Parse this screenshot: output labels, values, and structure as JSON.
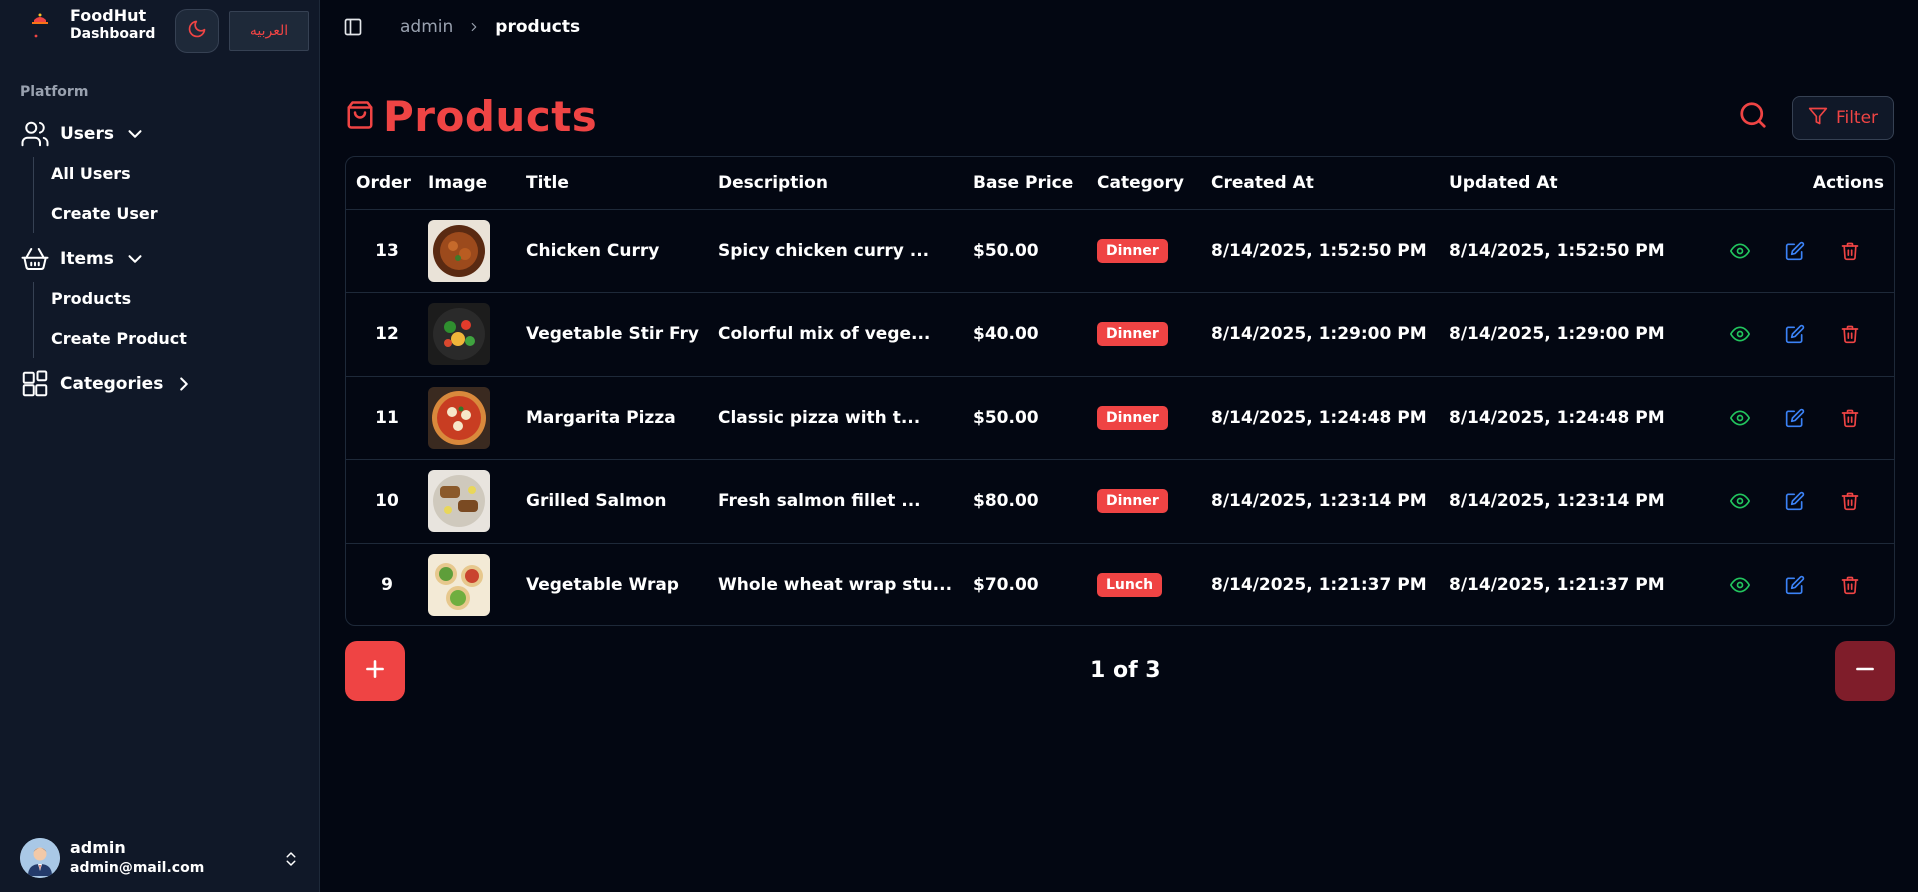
{
  "brand": {
    "name": "FoodHut",
    "subtitle": "Dashboard"
  },
  "header": {
    "language_button": "العربيه",
    "breadcrumb": [
      "admin",
      "products"
    ]
  },
  "sidebar": {
    "section_label": "Platform",
    "groups": [
      {
        "label": "Users",
        "icon": "users-icon",
        "expanded": true,
        "items": [
          "All Users",
          "Create User"
        ]
      },
      {
        "label": "Items",
        "icon": "basket-icon",
        "expanded": true,
        "items": [
          "Products",
          "Create Product"
        ]
      },
      {
        "label": "Categories",
        "icon": "grid-icon",
        "expanded": false,
        "items": []
      }
    ],
    "user": {
      "name": "admin",
      "email": "admin@mail.com"
    }
  },
  "page": {
    "title": "Products",
    "filter_label": "Filter",
    "pagination": "1 of 3"
  },
  "table": {
    "columns": [
      "Order",
      "Image",
      "Title",
      "Description",
      "Base Price",
      "Category",
      "Created At",
      "Updated At",
      "Actions"
    ],
    "rows": [
      {
        "order": "13",
        "image": "chicken-curry-photo",
        "title": "Chicken Curry",
        "description": "Spicy chicken curry ...",
        "price": "$50.00",
        "category": "Dinner",
        "created": "8/14/2025, 1:52:50 PM",
        "updated": "8/14/2025, 1:52:50 PM"
      },
      {
        "order": "12",
        "image": "vegetable-stir-fry-photo",
        "title": "Vegetable Stir Fry",
        "description": "Colorful mix of vege...",
        "price": "$40.00",
        "category": "Dinner",
        "created": "8/14/2025, 1:29:00 PM",
        "updated": "8/14/2025, 1:29:00 PM"
      },
      {
        "order": "11",
        "image": "margarita-pizza-photo",
        "title": "Margarita Pizza",
        "description": "Classic pizza with t...",
        "price": "$50.00",
        "category": "Dinner",
        "created": "8/14/2025, 1:24:48 PM",
        "updated": "8/14/2025, 1:24:48 PM"
      },
      {
        "order": "10",
        "image": "grilled-salmon-photo",
        "title": "Grilled Salmon",
        "description": "Fresh salmon fillet ...",
        "price": "$80.00",
        "category": "Dinner",
        "created": "8/14/2025, 1:23:14 PM",
        "updated": "8/14/2025, 1:23:14 PM"
      },
      {
        "order": "9",
        "image": "vegetable-wrap-photo",
        "title": "Vegetable Wrap",
        "description": "Whole wheat wrap stu...",
        "price": "$70.00",
        "category": "Lunch",
        "created": "8/14/2025, 1:21:37 PM",
        "updated": "8/14/2025, 1:21:37 PM"
      }
    ]
  },
  "colors": {
    "accent": "#ef4444",
    "view": "#22c55e",
    "edit": "#3b82f6",
    "delete": "#ef4444",
    "background": "#030712",
    "sidebar": "#101828"
  }
}
